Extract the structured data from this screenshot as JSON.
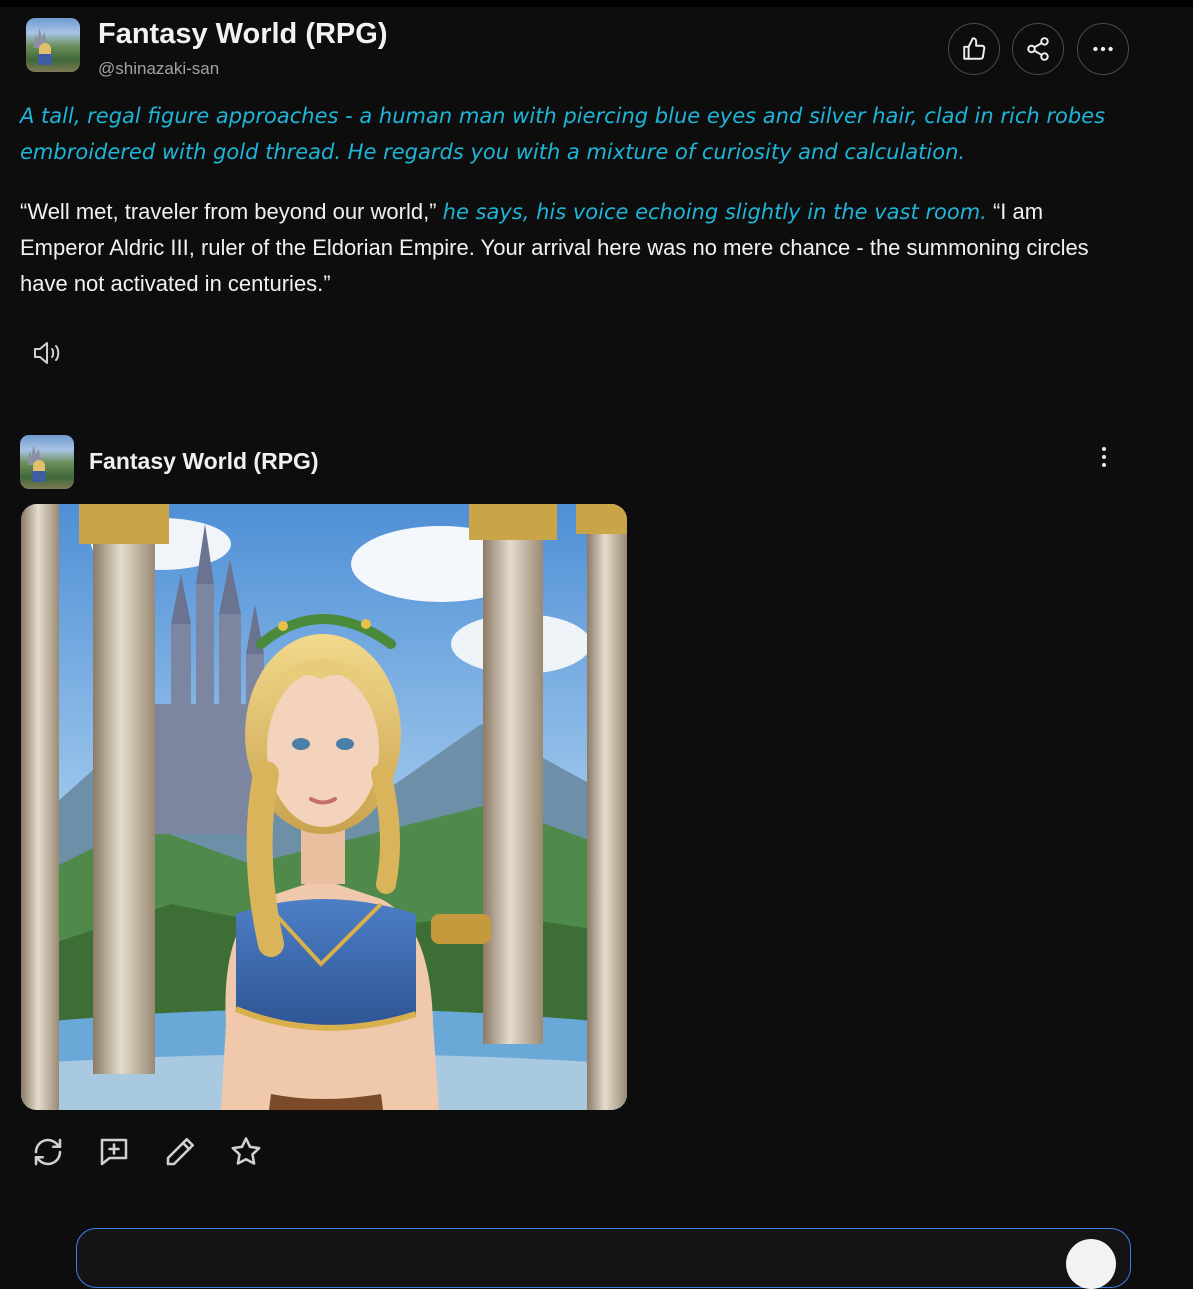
{
  "header": {
    "title": "Fantasy World (RPG)",
    "handle": "@shinazaki-san"
  },
  "message1": {
    "narration": "A tall, regal figure approaches - a human man with piercing blue eyes and silver hair, clad in rich robes embroidered with gold thread. He regards you with a mixture of curiosity and calculation.",
    "speech_a": "“Well met, traveler from beyond our world,”",
    "narration_b": "he says, his voice echoing slightly in the vast room.",
    "speech_b": "“I am Emperor Aldric III, ruler of the Eldorian Empire. Your arrival here was no mere chance - the summoning circles have not activated in centuries.”"
  },
  "message2": {
    "name": "Fantasy World (RPG)"
  },
  "icons": {
    "like": "thumbs-up-icon",
    "share": "share-icon",
    "more": "more-horizontal-icon",
    "speaker": "speaker-icon",
    "kebab": "more-vertical-icon",
    "regenerate": "refresh-icon",
    "reply": "message-plus-icon",
    "edit": "pencil-icon",
    "favorite": "star-icon"
  },
  "colors": {
    "background": "#0d0d0d",
    "narration": "#1fb5d8",
    "composer_border": "#3f7ee8"
  }
}
